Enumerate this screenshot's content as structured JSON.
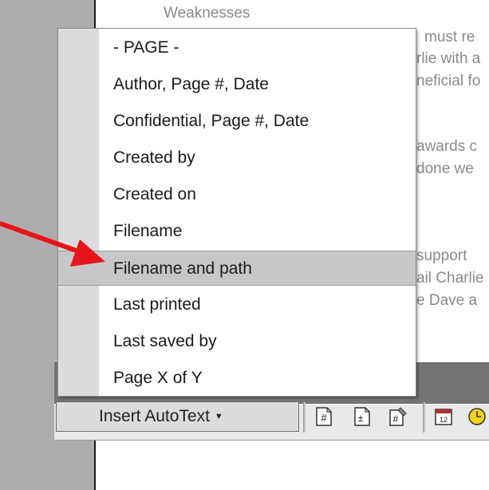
{
  "document": {
    "lines": [
      {
        "id": "weaknesses",
        "text": "Weaknesses"
      },
      {
        "id": "l1",
        "text": "must re"
      },
      {
        "id": "l2",
        "text": "rlie with a"
      },
      {
        "id": "l3",
        "text": "neficial fo"
      },
      {
        "id": "l4",
        "text": "awards c"
      },
      {
        "id": "l5",
        "text": "done we"
      },
      {
        "id": "l6",
        "text": "support"
      },
      {
        "id": "l7",
        "text": "ail Charlie"
      },
      {
        "id": "l8",
        "text": "e Dave a"
      }
    ]
  },
  "menu": {
    "items": [
      {
        "label": "- PAGE -"
      },
      {
        "label": "Author, Page #, Date"
      },
      {
        "label": "Confidential, Page #, Date"
      },
      {
        "label": "Created by"
      },
      {
        "label": "Created on"
      },
      {
        "label": "Filename"
      },
      {
        "label": "Filename and path"
      },
      {
        "label": "Last printed"
      },
      {
        "label": "Last saved by"
      },
      {
        "label": "Page X of Y"
      }
    ],
    "selected_index": 6
  },
  "toolbar": {
    "insert_autotext_label": "Insert AutoText",
    "icons": [
      "insert-page-number-icon",
      "insert-number-of-pages-icon",
      "format-page-number-icon",
      "insert-date-icon",
      "insert-time-icon"
    ]
  },
  "colors": {
    "highlight": "#c7c7ca",
    "arrow": "#e8141b",
    "gutter": "#dcdcdc"
  }
}
